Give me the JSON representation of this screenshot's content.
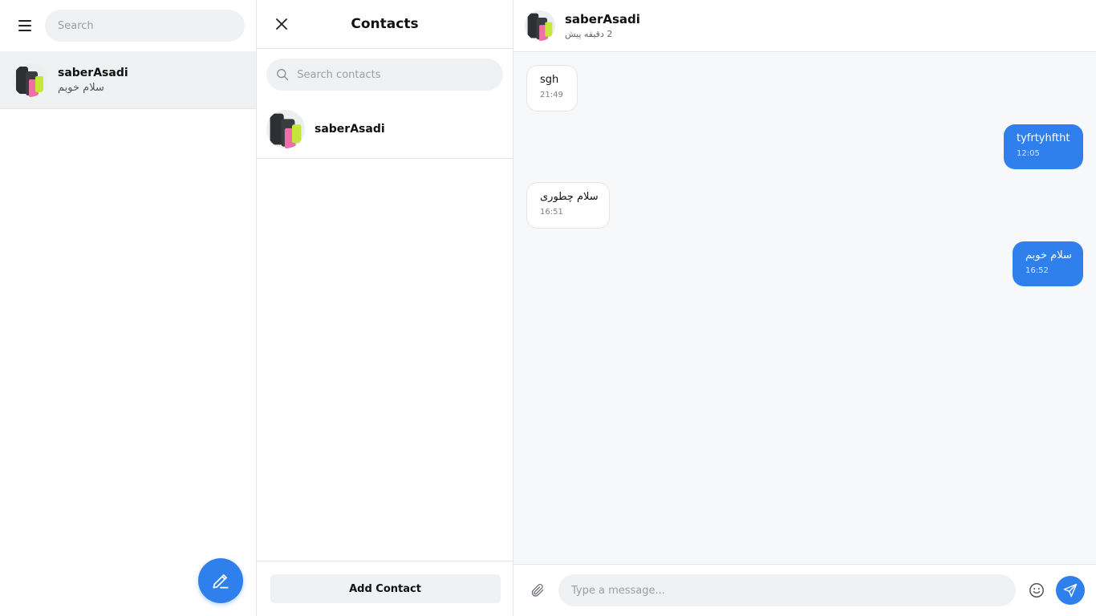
{
  "sidebar": {
    "search_placeholder": "Search",
    "chats": [
      {
        "name": "saberAsadi",
        "preview": "سلام خوبم"
      }
    ],
    "icons": {
      "menu": "hamburger-menu-icon",
      "compose": "pencil-icon"
    }
  },
  "contacts_panel": {
    "title": "Contacts",
    "search_placeholder": "Search contacts",
    "contacts": [
      {
        "name": "saberAsadi"
      }
    ],
    "add_label": "Add Contact"
  },
  "chat": {
    "name": "saberAsadi",
    "last_seen": "2 دقیقه پیش",
    "messages": [
      {
        "direction": "in",
        "text": "sgh",
        "time": "21:49"
      },
      {
        "direction": "out",
        "text": "tyfrtyhftht",
        "time": "12:05"
      },
      {
        "direction": "in",
        "text": "سلام چطوری",
        "time": "16:51"
      },
      {
        "direction": "out",
        "text": "سلام خوبم",
        "time": "16:52"
      }
    ],
    "composer_placeholder": "Type a message..."
  },
  "colors": {
    "accent": "#2f80ed",
    "panel_bg": "#f7f8fa",
    "pill_bg": "#f0f1f3",
    "border": "#e3e5e8"
  }
}
